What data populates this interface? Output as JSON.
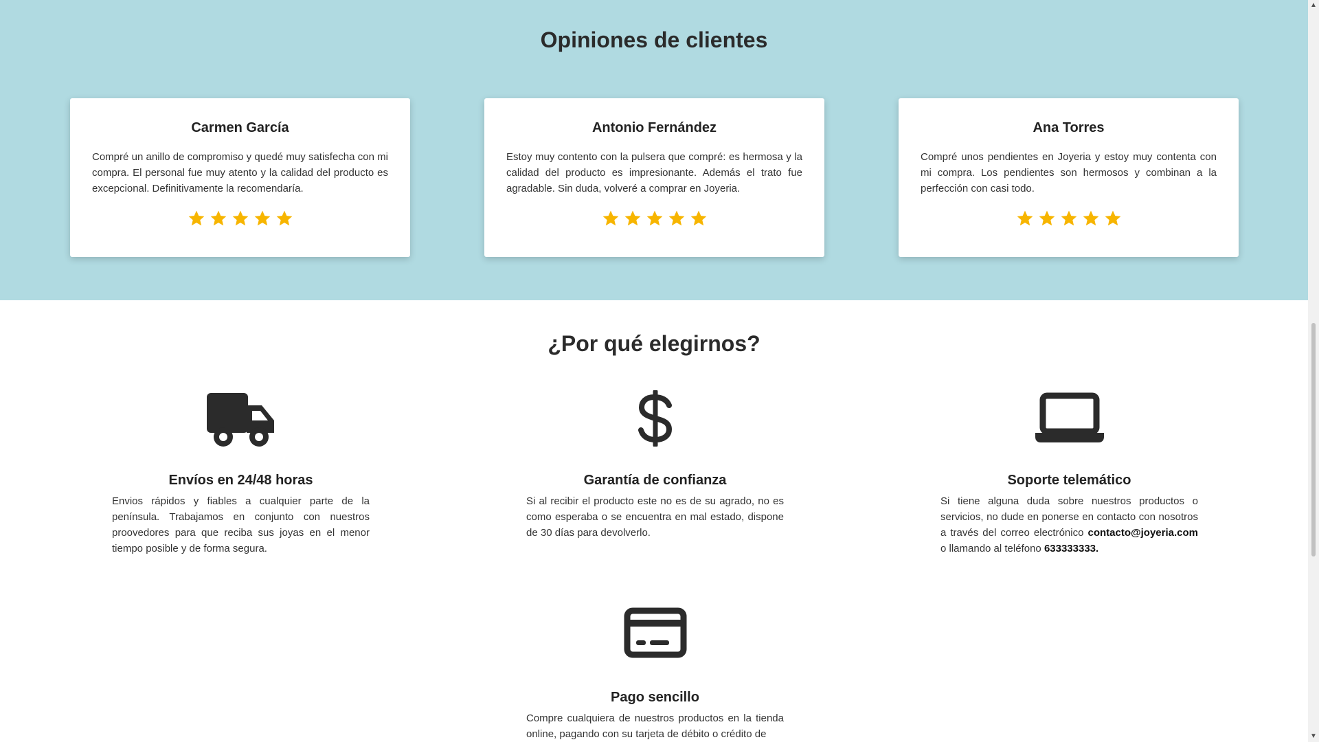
{
  "reviews": {
    "title": "Opiniones de clientes",
    "star_color": "#f7b500",
    "items": [
      {
        "name": "Carmen García",
        "text": "Compré un anillo de compromiso y quedé muy satisfecha con mi compra. El personal fue muy atento y la calidad del producto es excepcional. Definitivamente la recomendaría.",
        "rating": 5
      },
      {
        "name": "Antonio Fernández",
        "text": "Estoy muy contento con la pulsera que compré: es hermosa y la calidad del producto es impresionante. Además el trato fue agradable. Sin duda, volveré a comprar en Joyeria.",
        "rating": 5
      },
      {
        "name": "Ana Torres",
        "text": "Compré unos pendientes en Joyeria y estoy muy contenta con mi compra. Los pendientes son hermosos y combinan a la perfección con casi todo.",
        "rating": 5
      }
    ]
  },
  "why": {
    "title": "¿Por qué elegirnos?",
    "features": [
      {
        "icon": "truck-icon",
        "title": "Envíos en 24/48 horas",
        "text": "Envios rápidos y fiables a cualquier parte de la península. Trabajamos en conjunto con nuestros proovedores para que reciba sus joyas en el menor tiempo posible y de forma segura."
      },
      {
        "icon": "dollar-icon",
        "title": "Garantía de confianza",
        "text": "Si al recibir el producto este no es de su agrado, no es como esperaba o se encuentra en mal estado, dispone de 30 días para devolverlo."
      },
      {
        "icon": "laptop-icon",
        "title": "Soporte telemático",
        "text_prefix": "Si tiene alguna duda sobre nuestros productos o servicios, no dude en ponerse en contacto con nosotros a través del correo electrónico ",
        "email": "contacto@joyeria.com",
        "text_middle": " o llamando al teléfono ",
        "phone": "633333333."
      },
      {
        "icon": "credit-card-icon",
        "title": "Pago sencillo",
        "text": "Compre cualquiera de nuestros productos en la tienda online, pagando con su tarjeta de débito o crédito de"
      }
    ]
  },
  "colors": {
    "reviews_background": "#b0dae1",
    "text": "#262626",
    "icon": "#2b2b2b"
  }
}
